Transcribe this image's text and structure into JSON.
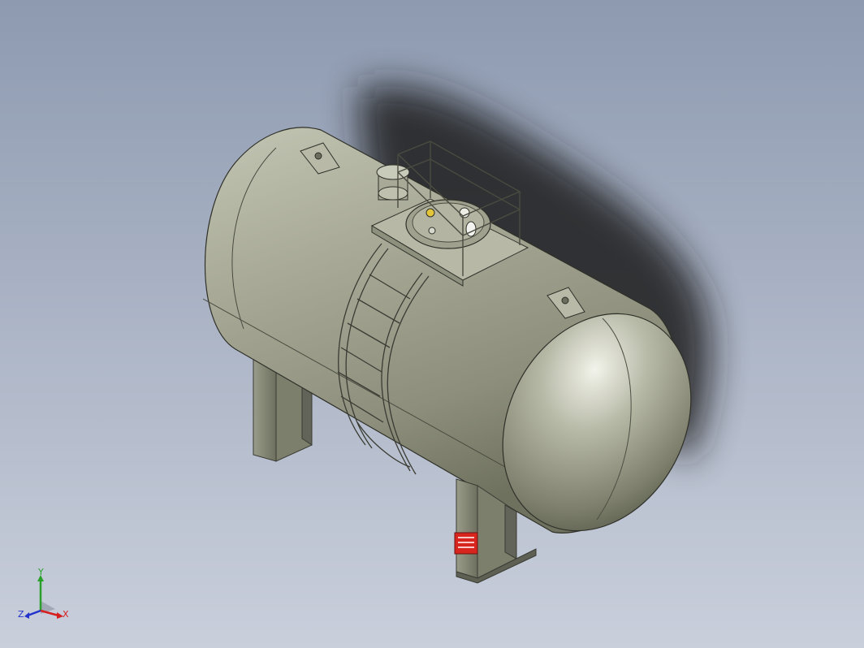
{
  "viewport": {
    "background_top": "#8d9ab0",
    "background_bottom": "#c9cfdb"
  },
  "model": {
    "body_color": "#a3a592",
    "shadow_color": "#1c1c1c",
    "warning_plate_color": "#d8261f"
  },
  "triad": {
    "x_label": "X",
    "y_label": "Y",
    "z_label": "Z",
    "x_color": "#d62020",
    "y_color": "#2aa02a",
    "z_color": "#2233cc"
  }
}
